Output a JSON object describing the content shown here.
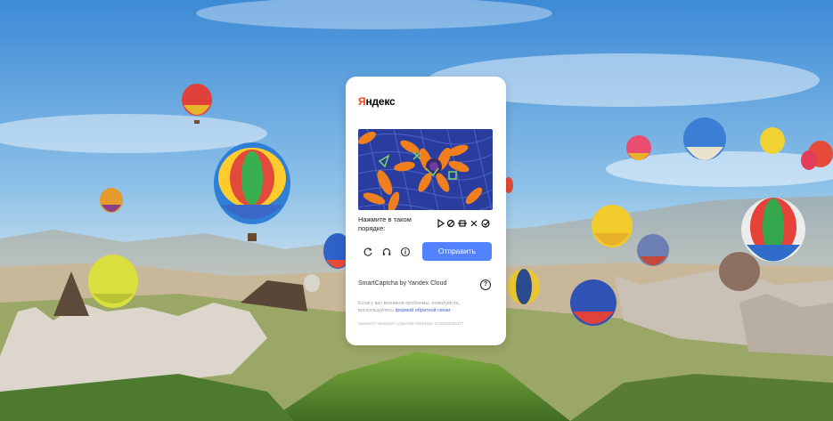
{
  "logo": "Яндекс",
  "captcha": {
    "task_label": "Нажмите в таком порядке:",
    "submit_label": "Отправить",
    "brand": "SmartCaptcha by Yandex Cloud",
    "help_label": "?",
    "note_prefix": "Если у вас возникли проблемы, пожалуйста, воспользуйтесь",
    "note_link": "формой обратной связи",
    "token": "a5a19e77-48a82e37-ccbee059-7b5916a1-1716822036377"
  },
  "icons": {
    "reload": "reload-icon",
    "audio": "headphones-icon",
    "info": "info-icon",
    "help": "question-icon"
  },
  "colors": {
    "accent": "#5282ff",
    "brand_red": "#fc3f1d",
    "link": "#3d64d1"
  }
}
